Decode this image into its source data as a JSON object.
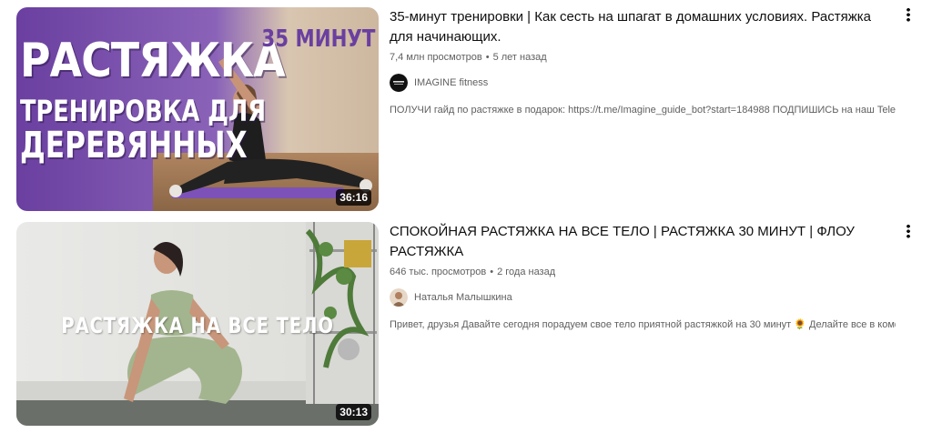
{
  "videos": [
    {
      "thumbnail": {
        "overlay_line1": "РАСТЯЖКА",
        "overlay_line2": "ТРЕНИРОВКА ДЛЯ",
        "overlay_line3": "ДЕРЕВЯННЫХ",
        "badge": "35 МИНУТ",
        "duration": "36:16"
      },
      "title": "35-минут тренировки | Как сесть на шпагат в домашних условиях. Растяжка для начинающих.",
      "views": "7,4 млн просмотров",
      "separator": "•",
      "age": "5 лет назад",
      "channel": "IMAGINE fitness",
      "description": "ПОЛУЧИ гайд по растяжке в подарок: https://t.me/Imagine_guide_bot?start=184988 ПОДПИШИСЬ на наш Telegram канал, ...",
      "menu_icon": "more-vert-icon"
    },
    {
      "thumbnail": {
        "overlay_line1": "РАСТЯЖКА НА ВСЕ ТЕЛО",
        "duration": "30:13"
      },
      "title": "СПОКОЙНАЯ РАСТЯЖКА НА ВСЕ ТЕЛО | РАСТЯЖКА 30 МИНУТ | ФЛОУ РАСТЯЖКА",
      "views": "646 тыс. просмотров",
      "separator": "•",
      "age": "2 года назад",
      "channel": "Наталья Малышкина",
      "description": "Привет, друзья Давайте сегодня порадуем свое тело приятной растяжкой на 30 минут 🌻 Делайте все в комфортном ...",
      "menu_icon": "more-vert-icon"
    }
  ]
}
